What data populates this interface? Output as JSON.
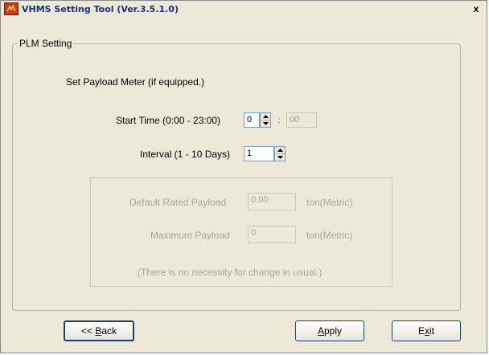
{
  "window": {
    "title": "VHMS Setting Tool  (Ver.3.5.1.0)",
    "close_label": "x"
  },
  "group": {
    "legend": "PLM Setting",
    "instruction": "Set Payload Meter (if equipped.)",
    "start_time": {
      "label": "Start Time (0:00 - 23:00)",
      "hour_value": "0",
      "separator": ":",
      "minute_value": "00"
    },
    "interval": {
      "label": "Interval (1 - 10 Days)",
      "value": "1"
    },
    "payload": {
      "default_rated": {
        "label": "Default Rated Payload",
        "value": "0.00",
        "unit": "ton(Metric)"
      },
      "maximum": {
        "label": "Maximum Payload",
        "value": "0",
        "unit": "ton(Metric)"
      },
      "note": "(There is no necessity for change in usual.)"
    }
  },
  "buttons": {
    "back": {
      "prefix": "<< ",
      "mnemonic": "B",
      "rest": "ack"
    },
    "apply": {
      "mnemonic": "A",
      "rest": "pply"
    },
    "exit": {
      "start": "E",
      "mnemonic": "x",
      "rest": "it"
    }
  }
}
